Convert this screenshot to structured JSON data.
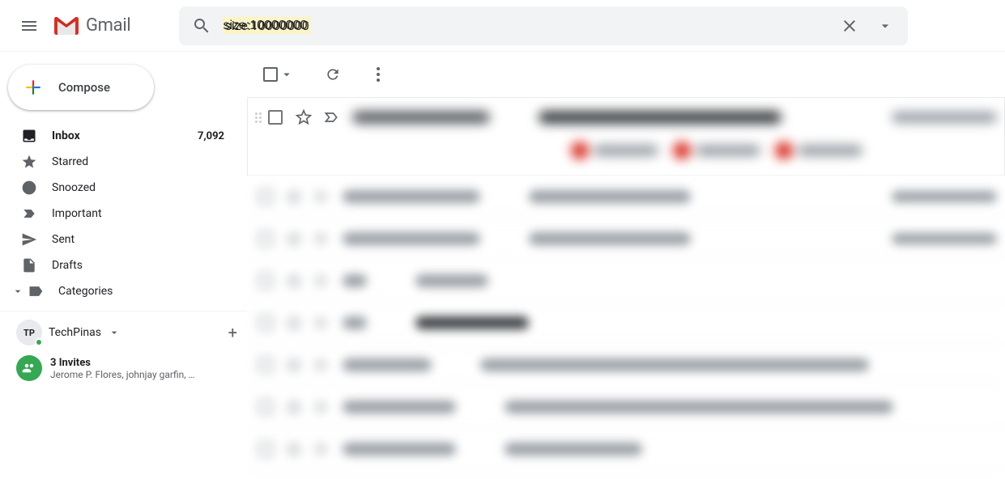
{
  "app_name": "Gmail",
  "search": {
    "value": "size:10000000"
  },
  "compose_label": "Compose",
  "sidebar": {
    "items": [
      {
        "id": "inbox",
        "label": "Inbox",
        "count": "7,092",
        "bold": true,
        "icon": "inbox-icon"
      },
      {
        "id": "starred",
        "label": "Starred",
        "icon": "star-icon"
      },
      {
        "id": "snoozed",
        "label": "Snoozed",
        "icon": "clock-icon"
      },
      {
        "id": "important",
        "label": "Important",
        "icon": "important-icon"
      },
      {
        "id": "sent",
        "label": "Sent",
        "icon": "sent-icon"
      },
      {
        "id": "drafts",
        "label": "Drafts",
        "icon": "drafts-icon"
      },
      {
        "id": "categories",
        "label": "Categories",
        "icon": "label-icon",
        "expandable": true
      }
    ]
  },
  "hangouts": {
    "user": "TechPinas",
    "invite_title": "3 Invites",
    "invite_sub": "Jerome P. Flores, johnjay garfin, …"
  }
}
